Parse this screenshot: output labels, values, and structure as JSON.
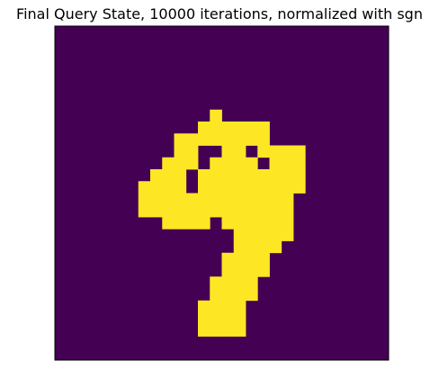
{
  "chart_data": {
    "type": "heatmap",
    "title": "Final Query State, 10000 iterations, normalized with sgn",
    "colormap": "viridis",
    "colors": {
      "low": "#440154",
      "high": "#fde725",
      "frame": "#000000"
    },
    "grid": false,
    "value_legend": {
      "-1": "low",
      "1": "high"
    },
    "rows": 28,
    "cols": 28,
    "high_cells_by_row": [
      [],
      [],
      [],
      [],
      [],
      [],
      [],
      [
        [
          13,
          13
        ]
      ],
      [
        [
          12,
          17
        ]
      ],
      [
        [
          10,
          17
        ]
      ],
      [
        [
          10,
          11
        ],
        [
          14,
          15
        ],
        [
          17,
          20
        ]
      ],
      [
        [
          9,
          11
        ],
        [
          13,
          16
        ],
        [
          18,
          20
        ]
      ],
      [
        [
          8,
          10
        ],
        [
          12,
          20
        ]
      ],
      [
        [
          7,
          10
        ],
        [
          12,
          20
        ]
      ],
      [
        [
          7,
          19
        ]
      ],
      [
        [
          7,
          19
        ]
      ],
      [
        [
          9,
          12
        ],
        [
          14,
          19
        ]
      ],
      [
        [
          15,
          19
        ]
      ],
      [
        [
          15,
          18
        ]
      ],
      [
        [
          14,
          17
        ]
      ],
      [
        [
          14,
          17
        ]
      ],
      [
        [
          13,
          16
        ]
      ],
      [
        [
          13,
          16
        ]
      ],
      [
        [
          12,
          15
        ]
      ],
      [
        [
          12,
          15
        ]
      ],
      [
        [
          12,
          15
        ]
      ],
      [],
      []
    ]
  }
}
